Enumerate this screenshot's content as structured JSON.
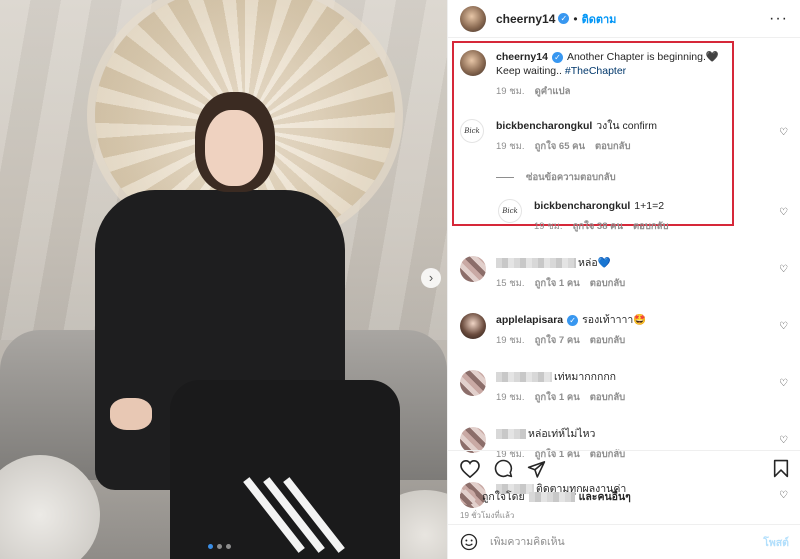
{
  "header": {
    "username": "cheerny14",
    "verified_icon": "verified-badge-icon",
    "separator": "•",
    "follow_label": "ติดตาม",
    "more_icon": "more-options-icon",
    "more_glyph": "···"
  },
  "photo": {
    "next_icon": "chevron-right-icon",
    "next_glyph": "›",
    "carousel_dots": 3,
    "active_dot": 1
  },
  "caption": {
    "username": "cheerny14",
    "text": "Another Chapter is beginning.🖤",
    "text2": "Keep waiting.. ",
    "hashtag": "#TheChapter",
    "time": "19 ชม.",
    "translate": "ดูคำแปล"
  },
  "comments": [
    {
      "username": "bickbencharongkul",
      "text": "วงใน confirm",
      "time": "19 ชม.",
      "likes": "ถูกใจ 65 คน",
      "reply": "ตอบกลับ"
    },
    {
      "text": "หล่อ💙",
      "time": "15 ชม.",
      "likes": "ถูกใจ 1 คน",
      "reply": "ตอบกลับ"
    },
    {
      "username": "applelapisara",
      "text": "รองเท้าาาา🤩",
      "time": "19 ชม.",
      "likes": "ถูกใจ 7 คน",
      "reply": "ตอบกลับ"
    },
    {
      "text": "เท่หมากกกกก",
      "time": "19 ชม.",
      "likes": "ถูกใจ 1 คน",
      "reply": "ตอบกลับ"
    },
    {
      "text": "หล่อเท่ห์ไม่ไหว",
      "time": "19 ชม.",
      "likes": "ถูกใจ 1 คน",
      "reply": "ตอบกลับ"
    },
    {
      "text": "ติดตามทุกผลงานค่า"
    }
  ],
  "hide_replies": "ซ่อนข้อความตอบกลับ",
  "reply": {
    "username": "bickbencharongkul",
    "text": "1+1=2",
    "time": "19 ชม.",
    "likes": "ถูกใจ 38 คน",
    "reply": "ตอบกลับ"
  },
  "signature_avatar_text": "Bick",
  "heart_glyph": "♡",
  "actions": {
    "like_icon": "heart-icon",
    "comment_icon": "comment-icon",
    "share_icon": "share-icon",
    "save_icon": "bookmark-icon"
  },
  "likes_summary": {
    "prefix": "ถูกใจโดย",
    "suffix": "และคนอื่นๆ"
  },
  "post_time": "19 ชั่วโมงที่แล้ว",
  "add_comment": {
    "emoji_icon": "emoji-icon",
    "placeholder": "เพิ่มความคิดเห็น",
    "post_label": "โพสต์"
  },
  "colors": {
    "accent": "#0095f6",
    "highlight_box": "#d62839",
    "verified": "#3897f0"
  }
}
